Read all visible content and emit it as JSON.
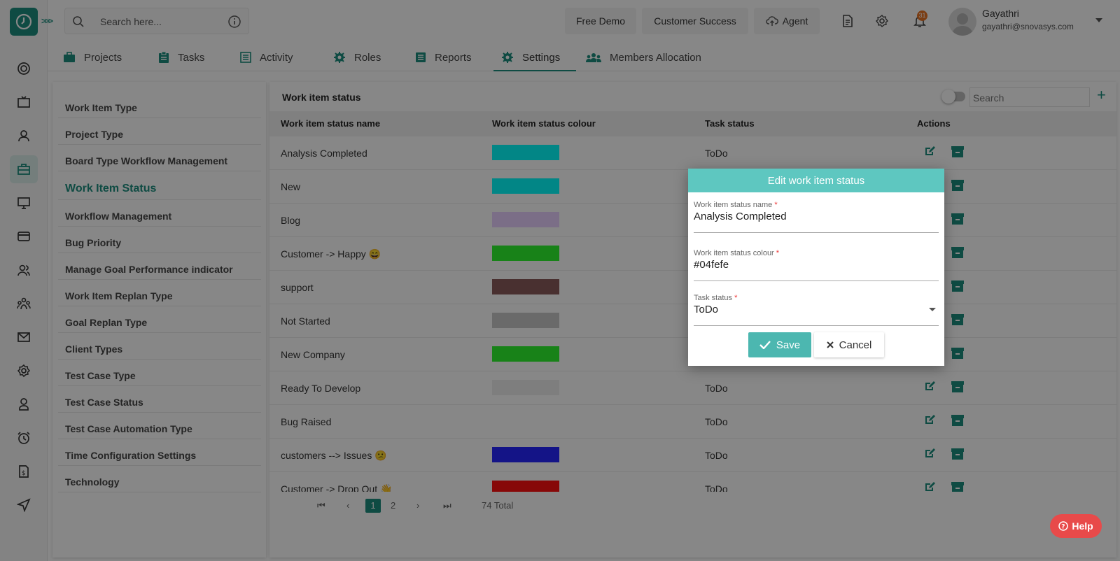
{
  "header": {
    "search_placeholder": "Search here...",
    "buttons": {
      "free_demo": "Free Demo",
      "customer_success": "Customer Success",
      "agent": "Agent"
    },
    "notification_count": "31",
    "user": {
      "name": "Gayathri",
      "email": "gayathri@snovasys.com"
    }
  },
  "tabs": [
    {
      "label": "Projects"
    },
    {
      "label": "Tasks"
    },
    {
      "label": "Activity"
    },
    {
      "label": "Roles"
    },
    {
      "label": "Reports"
    },
    {
      "label": "Settings",
      "active": true
    },
    {
      "label": "Members Allocation"
    }
  ],
  "settings_menu": [
    "Work Item Type",
    "Project Type",
    "Board Type Workflow Management",
    "Work Item Status",
    "Workflow Management",
    "Bug Priority",
    "Manage Goal Performance indicator",
    "Work Item Replan Type",
    "Goal Replan Type",
    "Client Types",
    "Test Case Type",
    "Test Case Status",
    "Test Case Automation Type",
    "Time Configuration Settings",
    "Technology"
  ],
  "panel": {
    "title": "Work item status",
    "search_placeholder": "Search",
    "columns": [
      "Work item status name",
      "Work item status colour",
      "Task status",
      "Actions"
    ],
    "rows": [
      {
        "name": "Analysis Completed",
        "color": "#04fefe",
        "task_status": "ToDo"
      },
      {
        "name": "New",
        "color": "#04fefe",
        "task_status": ""
      },
      {
        "name": "Blog",
        "color": "#e8d0ff",
        "task_status": ""
      },
      {
        "name": "Customer -> Happy 😄",
        "color": "#2ef52e",
        "task_status": ""
      },
      {
        "name": "support",
        "color": "#8a5c5c",
        "task_status": ""
      },
      {
        "name": "Not Started",
        "color": "#c8c8c8",
        "task_status": ""
      },
      {
        "name": "New Company",
        "color": "#2ef52e",
        "task_status": ""
      },
      {
        "name": "Ready To Develop",
        "color": "#efefef",
        "task_status": "ToDo"
      },
      {
        "name": "Bug Raised",
        "color": "",
        "task_status": "ToDo"
      },
      {
        "name": "customers --> Issues 😕",
        "color": "#2626ff",
        "task_status": "ToDo"
      },
      {
        "name": "Customer -> Drop Out 👋",
        "color": "#ff1010",
        "task_status": "ToDo"
      }
    ],
    "pagination": {
      "pages": [
        "1",
        "2"
      ],
      "current": "1",
      "total": "74 Total"
    }
  },
  "dialog": {
    "title": "Edit work item status",
    "fields": {
      "name": {
        "label": "Work item status name",
        "value": "Analysis Completed"
      },
      "colour": {
        "label": "Work item status colour",
        "value": "#04fefe"
      },
      "task_status": {
        "label": "Task status",
        "value": "ToDo"
      }
    },
    "save_label": "Save",
    "cancel_label": "Cancel"
  },
  "help_label": "Help",
  "colors": {
    "brand": "#1d8f7f",
    "dialog_header": "#5ec7c0",
    "help": "#e84a4a"
  }
}
